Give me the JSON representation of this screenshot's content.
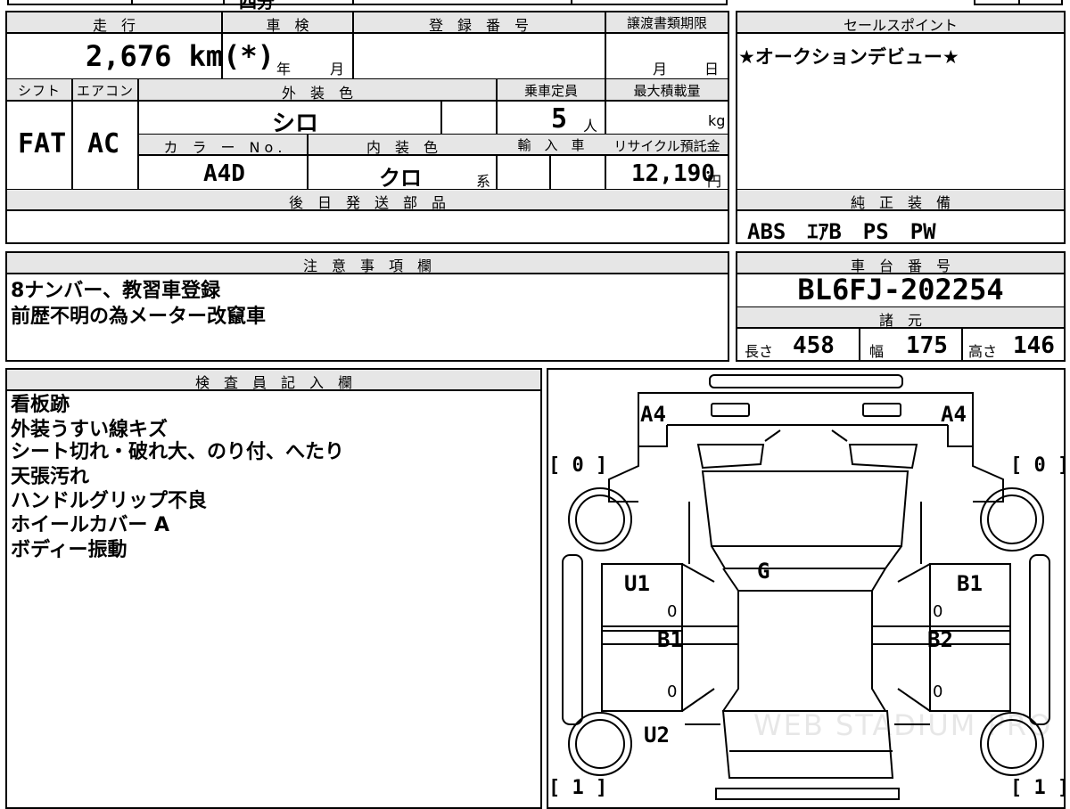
{
  "top_strip": {
    "fragment": "四分"
  },
  "headers": {
    "mileage": "走　行",
    "inspection": "車　検",
    "registration": "登　録　番　号",
    "transfer_deadline": "譲渡書類期限",
    "sales_point": "セールスポイント",
    "shift": "シフト",
    "aircon": "エアコン",
    "exterior_color": "外　装　色",
    "capacity": "乗車定員",
    "max_load": "最大積載量",
    "color_no": "カ　ラ　ー　N o .",
    "interior_color": "内　装　色",
    "import": "輸　入　車",
    "recycle_fee": "リサイクル預託金",
    "later_parts": "後　日　発　送　部　品",
    "genuine_equipment": "純　正　装　備",
    "notes": "注　意　事　項　欄",
    "chassis_no": "車　台　番　号",
    "specs": "諸　元",
    "inspector": "検　査　員　記　入　欄"
  },
  "values": {
    "mileage": "2,676 km(*)",
    "inspection_year_unit": "年",
    "inspection_month_unit": "月",
    "deadline_month_unit": "月",
    "deadline_day_unit": "日",
    "shift": "FAT",
    "aircon": "AC",
    "exterior_color": "シロ",
    "capacity": "5",
    "capacity_unit": "人",
    "max_load_unit": "kg",
    "color_no": "A4D",
    "interior_color": "クロ",
    "interior_suffix": "系",
    "recycle_fee": "12,190",
    "recycle_unit": "円",
    "sales_point": "★オークションデビュー★",
    "genuine_equipment": "ABS　ｴｱB　PS　PW",
    "chassis_no": "BL6FJ-202254",
    "length_label": "長さ",
    "length": "458",
    "width_label": "幅",
    "width": "175",
    "height_label": "高さ",
    "height": "146"
  },
  "notes_lines": [
    "8ナンバー、教習車登録",
    "前歴不明の為メーター改竄車"
  ],
  "inspector_lines": [
    "看板跡",
    "外装うすい線キズ",
    "シート切れ・破れ大、のり付、へたり",
    "天張汚れ",
    "ハンドルグリップ不良",
    "ホイールカバー A",
    "ボディー振動"
  ],
  "diagram": {
    "front_left_mark": "A4",
    "front_right_mark": "A4",
    "front_left_wheel": "[ 0 ]",
    "front_right_wheel": "[ 0 ]",
    "rear_left_wheel": "[ 1 ]",
    "rear_right_wheel": "[ 1 ]",
    "windshield_mark": "G",
    "front_left_door": "U1",
    "front_right_door": "B1",
    "rear_left_door_mark": "B1",
    "rear_right_door_mark": "B2",
    "rear_left_quarter": "U2",
    "door_zero_1": "0",
    "door_zero_2": "0",
    "door_zero_3": "0",
    "door_zero_4": "0",
    "watermark": "WEB STADIUM PRO"
  }
}
